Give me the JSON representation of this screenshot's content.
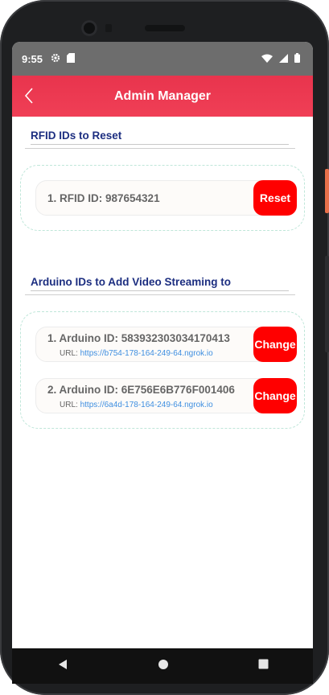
{
  "status_bar": {
    "time": "9:55",
    "icons": [
      "settings-icon",
      "sd-card-icon",
      "wifi-icon",
      "signal-icon",
      "battery-icon"
    ]
  },
  "header": {
    "title": "Admin Manager",
    "back_icon": "chevron-left-icon"
  },
  "rfid_section": {
    "title": "RFID IDs to Reset",
    "items": [
      {
        "label": "1. RFID ID: 987654321",
        "button": "Reset"
      }
    ]
  },
  "arduino_section": {
    "title": "Arduino IDs to Add Video Streaming to",
    "items": [
      {
        "label": "1. Arduino ID: 583932303034170413",
        "url_label": "URL:",
        "url": "https://b754-178-164-249-64.ngrok.io",
        "button": "Change"
      },
      {
        "label": "2. Arduino ID: 6E756E6B776F001406",
        "url_label": "URL:",
        "url": "https://6a4d-178-164-249-64.ngrok.io",
        "button": "Change"
      }
    ]
  },
  "colors": {
    "header": "#ef3a52",
    "button": "#ff0000",
    "section_title": "#1c2e80",
    "url": "#3f8fe0",
    "dashed_border": "#bfe6d9"
  },
  "nav_bar": {
    "icons": [
      "back-triangle-icon",
      "home-circle-icon",
      "recents-square-icon"
    ]
  }
}
